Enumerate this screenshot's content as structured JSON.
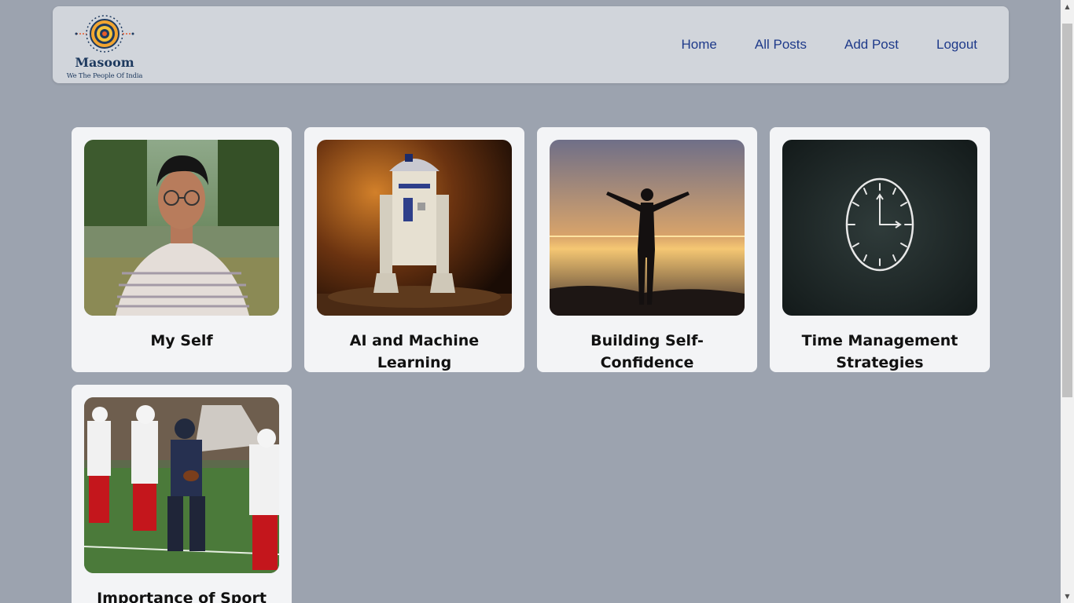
{
  "header": {
    "logo_name": "Masoom",
    "logo_tagline": "We The People Of India",
    "nav": [
      {
        "label": "Home"
      },
      {
        "label": "All Posts"
      },
      {
        "label": "Add Post"
      },
      {
        "label": "Logout"
      }
    ]
  },
  "posts": [
    {
      "title": "My Self",
      "image": "portrait-photo"
    },
    {
      "title": "AI and Machine Learning",
      "image": "robot-photo"
    },
    {
      "title": "Building Self-Confidence",
      "image": "sunset-silhouette-photo"
    },
    {
      "title": "Time Management Strategies",
      "image": "chalk-clock-photo"
    },
    {
      "title": "Importance of Sport",
      "image": "football-players-photo"
    }
  ],
  "colors": {
    "page_bg": "#9ca3af",
    "header_bg": "#d1d5db",
    "card_bg": "#f3f4f6",
    "nav_text": "#1e3a8a",
    "brand": "#1e3a5f"
  }
}
